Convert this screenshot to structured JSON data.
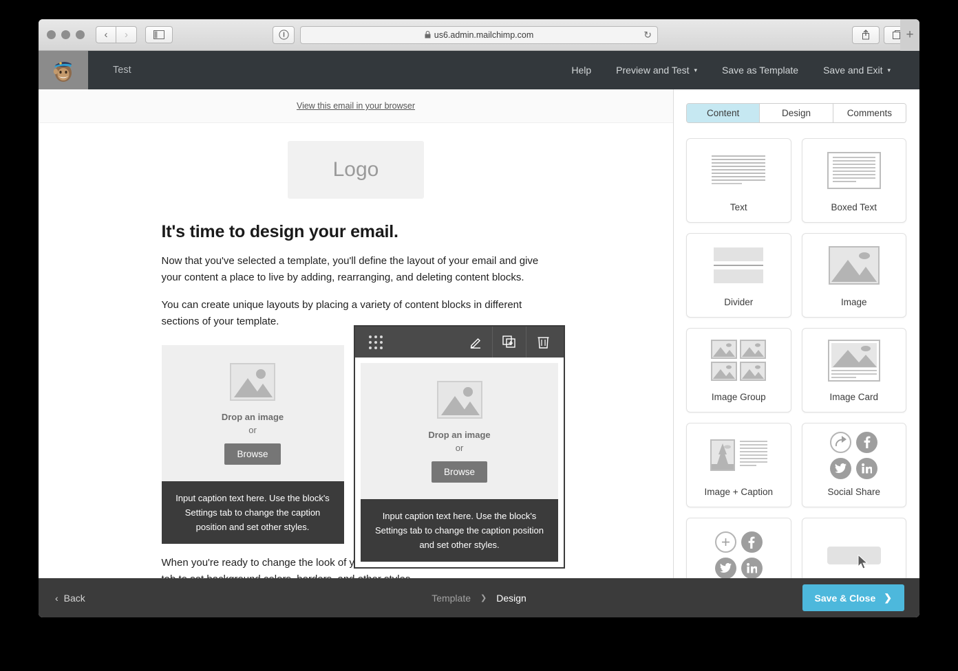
{
  "browser": {
    "url": "us6.admin.mailchimp.com",
    "lock_icon": "lock-icon",
    "back_icon": "chevron-left-icon",
    "forward_icon": "chevron-right-icon",
    "sidebar_icon": "sidebar-toggle-icon",
    "info_icon": "info-icon",
    "reload_icon": "reload-icon",
    "share_icon": "share-icon",
    "tabs_icon": "show-tabs-icon",
    "newtab_label": "+"
  },
  "appnav": {
    "logo": "mailchimp-freddie-logo",
    "campaign_name": "Test",
    "links": [
      {
        "label": "Help",
        "caret": false
      },
      {
        "label": "Preview and Test",
        "caret": true
      },
      {
        "label": "Save as Template",
        "caret": false
      },
      {
        "label": "Save and Exit",
        "caret": true
      }
    ],
    "caret_glyph": "▾"
  },
  "email": {
    "preheader_link": "View this email in your browser",
    "logo_placeholder": "Logo",
    "heading": "It's time to design your email.",
    "paragraph1": "Now that you've selected a template, you'll define the layout of your email and give your content a place to live by adding, rearranging, and deleting content blocks.",
    "paragraph2": "You can create unique layouts by placing a variety of content blocks in different sections of your template.",
    "paragraph3": "When you're ready to change the look of your email, take a look through the “design” tab to set background colors, borders, and other styles.",
    "image_block": {
      "drop_label": "Drop an image",
      "or_label": "or",
      "browse_label": "Browse",
      "caption": "Input caption text here. Use the block's Settings tab to change the caption position and set other styles."
    },
    "toolbar": {
      "drag_handle": "drag-handle-icon",
      "edit_icon": "pencil-edit-icon",
      "duplicate_icon": "duplicate-icon",
      "delete_icon": "trash-icon"
    }
  },
  "panel": {
    "tabs": [
      {
        "label": "Content",
        "active": true
      },
      {
        "label": "Design",
        "active": false
      },
      {
        "label": "Comments",
        "active": false
      }
    ],
    "blocks": [
      {
        "label": "Text",
        "art": "text"
      },
      {
        "label": "Boxed Text",
        "art": "boxed"
      },
      {
        "label": "Divider",
        "art": "divider"
      },
      {
        "label": "Image",
        "art": "image"
      },
      {
        "label": "Image Group",
        "art": "imagegroup"
      },
      {
        "label": "Image Card",
        "art": "imagecard"
      },
      {
        "label": "Image + Caption",
        "art": "imagecaption"
      },
      {
        "label": "Social Share",
        "art": "socialshare"
      },
      {
        "label": "",
        "art": "socialfollow"
      },
      {
        "label": "",
        "art": "button"
      }
    ]
  },
  "footer": {
    "back_label": "Back",
    "back_caret": "‹",
    "breadcrumb_prev": "Template",
    "breadcrumb_sep": "❯",
    "breadcrumb_current": "Design",
    "save_close_label": "Save & Close",
    "save_close_caret": "❯",
    "accent_color": "#4db8dc"
  }
}
